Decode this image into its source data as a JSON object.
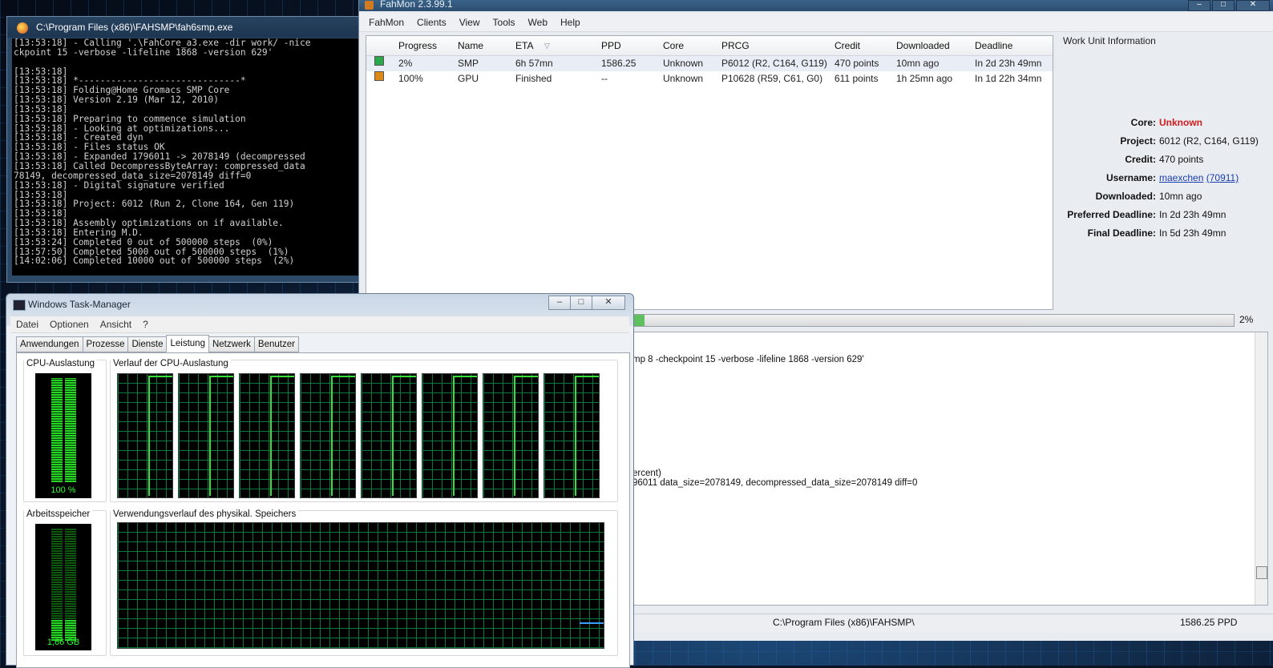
{
  "console": {
    "title": "C:\\Program Files (x86)\\FAHSMP\\fah6smp.exe",
    "lines": [
      "[13:53:18] - Calling '.\\FahCore_a3.exe -dir work/ -nice",
      "ckpoint 15 -verbose -lifeline 1868 -version 629'",
      "",
      "[13:53:18]",
      "[13:53:18] *------------------------------*",
      "[13:53:18] Folding@Home Gromacs SMP Core",
      "[13:53:18] Version 2.19 (Mar 12, 2010)",
      "[13:53:18]",
      "[13:53:18] Preparing to commence simulation",
      "[13:53:18] - Looking at optimizations...",
      "[13:53:18] - Created dyn",
      "[13:53:18] - Files status OK",
      "[13:53:18] - Expanded 1796011 -> 2078149 (decompressed",
      "[13:53:18] Called DecompressByteArray: compressed_data",
      "78149, decompressed_data_size=2078149 diff=0",
      "[13:53:18] - Digital signature verified",
      "[13:53:18]",
      "[13:53:18] Project: 6012 (Run 2, Clone 164, Gen 119)",
      "[13:53:18]",
      "[13:53:18] Assembly optimizations on if available.",
      "[13:53:18] Entering M.D.",
      "[13:53:24] Completed 0 out of 500000 steps  (0%)",
      "[13:57:50] Completed 5000 out of 500000 steps  (1%)",
      "[14:02:06] Completed 10000 out of 500000 steps  (2%)"
    ]
  },
  "fahmon": {
    "title": "FahMon 2.3.99.1",
    "menu": [
      "FahMon",
      "Clients",
      "View",
      "Tools",
      "Web",
      "Help"
    ],
    "columns": [
      "Progress",
      "Name",
      "ETA",
      "PPD",
      "Core",
      "PRCG",
      "Credit",
      "Downloaded",
      "Deadline"
    ],
    "rows": [
      {
        "progress": "2%",
        "name": "SMP",
        "eta": "6h 57mn",
        "ppd": "1586.25",
        "core": "Unknown",
        "prcg": "P6012 (R2, C164, G119)",
        "credit": "470 points",
        "downloaded": "10mn ago",
        "deadline": "In 2d 23h 49mn",
        "status_color": "#2aa84a"
      },
      {
        "progress": "100%",
        "name": "GPU",
        "eta": "Finished",
        "ppd": "--",
        "core": "Unknown",
        "prcg": "P10628 (R59, C61, G0)",
        "credit": "611 points",
        "downloaded": "1h 25mn ago",
        "deadline": "In 1d 22h 34mn",
        "status_color": "#d98a1a"
      }
    ],
    "wu_title": "Work Unit Information",
    "wu": {
      "core_label": "Core:",
      "core_value": "Unknown",
      "project_label": "Project:",
      "project_value": "6012 (R2, C164, G119)",
      "credit_label": "Credit:",
      "credit_value": "470 points",
      "username_label": "Username:",
      "username_value": "maexchen",
      "username_id": "(70911)",
      "downloaded_label": "Downloaded:",
      "downloaded_value": "10mn ago",
      "preferred_label": "Preferred Deadline:",
      "preferred_value": "In 2d 23h 49mn",
      "final_label": "Final Deadline:",
      "final_value": "In 5d 23h 49mn"
    },
    "progress_pct": "2%",
    "progress_value": 0.02,
    "log_lines": [
      "mp 8 -checkpoint 15 -verbose -lifeline 1868 -version 629'",
      "ercent)",
      "96011 data_size=2078149, decompressed_data_size=2078149 diff=0"
    ],
    "status_path": "C:\\Program Files (x86)\\FAHSMP\\",
    "status_ppd": "1586.25 PPD"
  },
  "taskmgr": {
    "title": "Windows Task-Manager",
    "menu": [
      "Datei",
      "Optionen",
      "Ansicht",
      "?"
    ],
    "tabs": [
      "Anwendungen",
      "Prozesse",
      "Dienste",
      "Leistung",
      "Netzwerk",
      "Benutzer"
    ],
    "active_tab": "Leistung",
    "cpu_label": "CPU-Auslastung",
    "cpu_value": "100 %",
    "cpu_level": 1.0,
    "cpu_history_label": "Verlauf der CPU-Auslastung",
    "cpu_cores": 8,
    "mem_label": "Arbeitsspeicher",
    "mem_value": "1,66 GB",
    "mem_history_label": "Verwendungsverlauf des physikal. Speichers",
    "btn_min": "–",
    "btn_max": "□",
    "btn_close": "✕"
  }
}
